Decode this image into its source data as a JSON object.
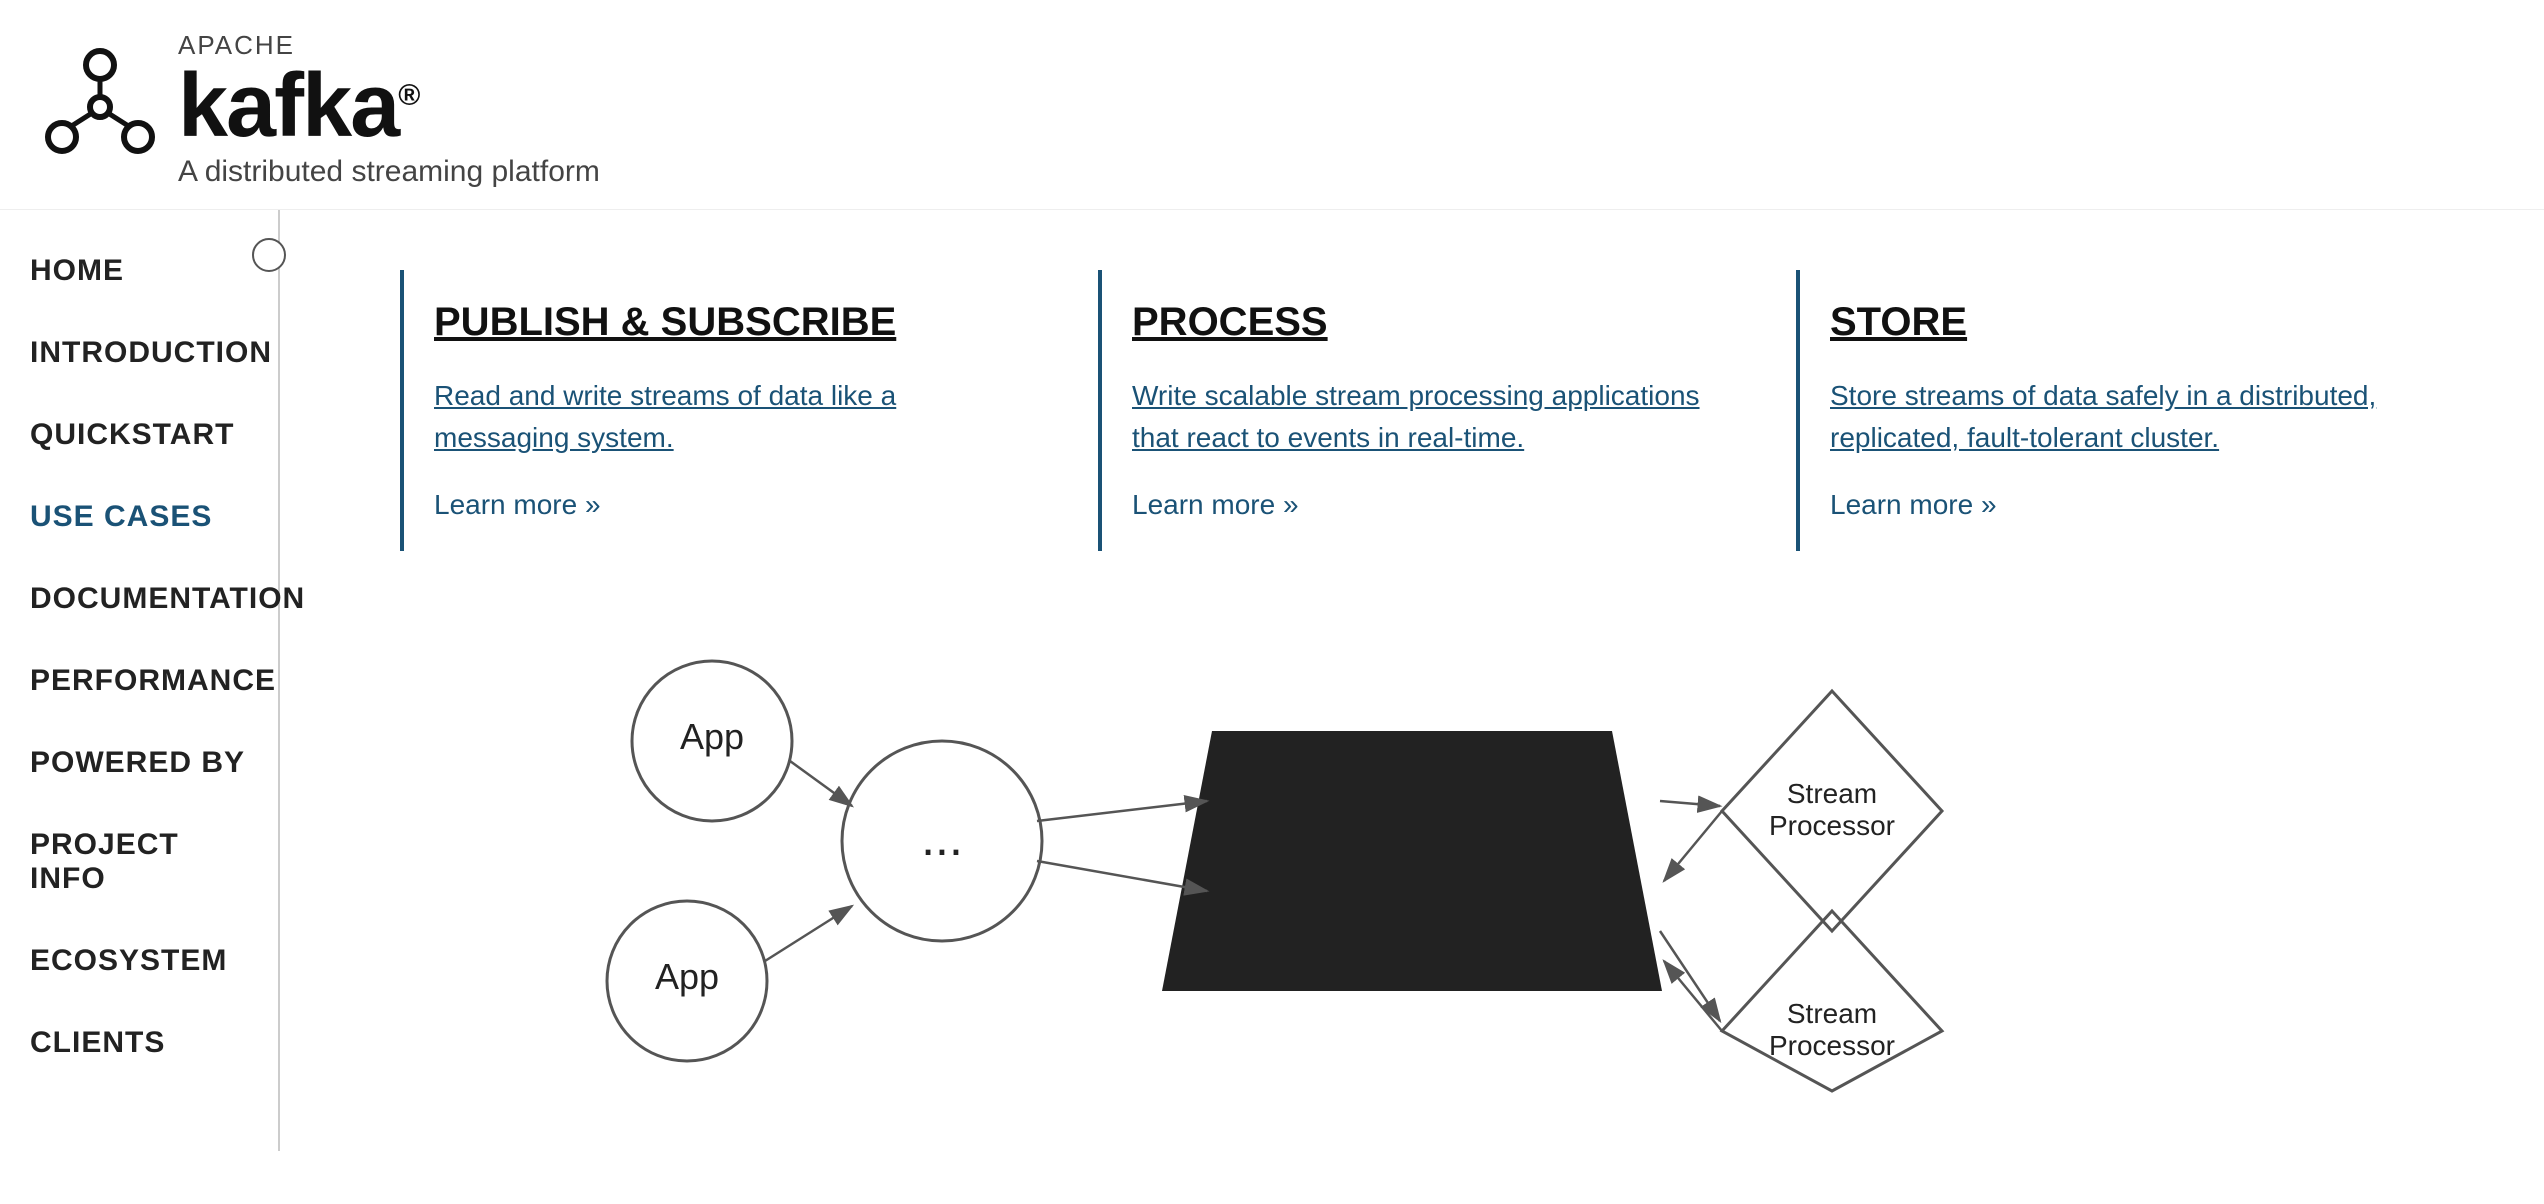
{
  "header": {
    "apache_label": "APACHE",
    "kafka_label": "kafka",
    "registered_mark": "®",
    "tagline": "A distributed streaming platform"
  },
  "sidebar": {
    "items": [
      {
        "label": "HOME",
        "active": false
      },
      {
        "label": "INTRODUCTION",
        "active": false
      },
      {
        "label": "QUICKSTART",
        "active": false
      },
      {
        "label": "USE CASES",
        "active": true
      },
      {
        "label": "DOCUMENTATION",
        "active": false
      },
      {
        "label": "PERFORMANCE",
        "active": false
      },
      {
        "label": "POWERED BY",
        "active": false
      },
      {
        "label": "PROJECT INFO",
        "active": false
      },
      {
        "label": "ECOSYSTEM",
        "active": false
      },
      {
        "label": "CLIENTS",
        "active": false
      }
    ]
  },
  "main": {
    "columns": [
      {
        "title": "PUBLISH & SUBSCRIBE",
        "description": "Read and write streams of data like a messaging system.",
        "link": "Learn more »"
      },
      {
        "title": "PROCESS",
        "description": "Write scalable stream processing applications that react to events in real-time.",
        "link": "Learn more »"
      },
      {
        "title": "STORE",
        "description": "Store streams of data safely in a distributed, replicated, fault-tolerant cluster.",
        "link": "Learn more »"
      }
    ]
  },
  "diagram": {
    "app1_label": "App",
    "app2_label": "App",
    "dots_label": "...",
    "stream_processor1_label": "Stream\nProcessor",
    "stream_processor2_label": "Stream\nProcessor"
  },
  "colors": {
    "accent": "#1a5276",
    "border": "#555",
    "text_dark": "#111",
    "text_mid": "#444"
  }
}
